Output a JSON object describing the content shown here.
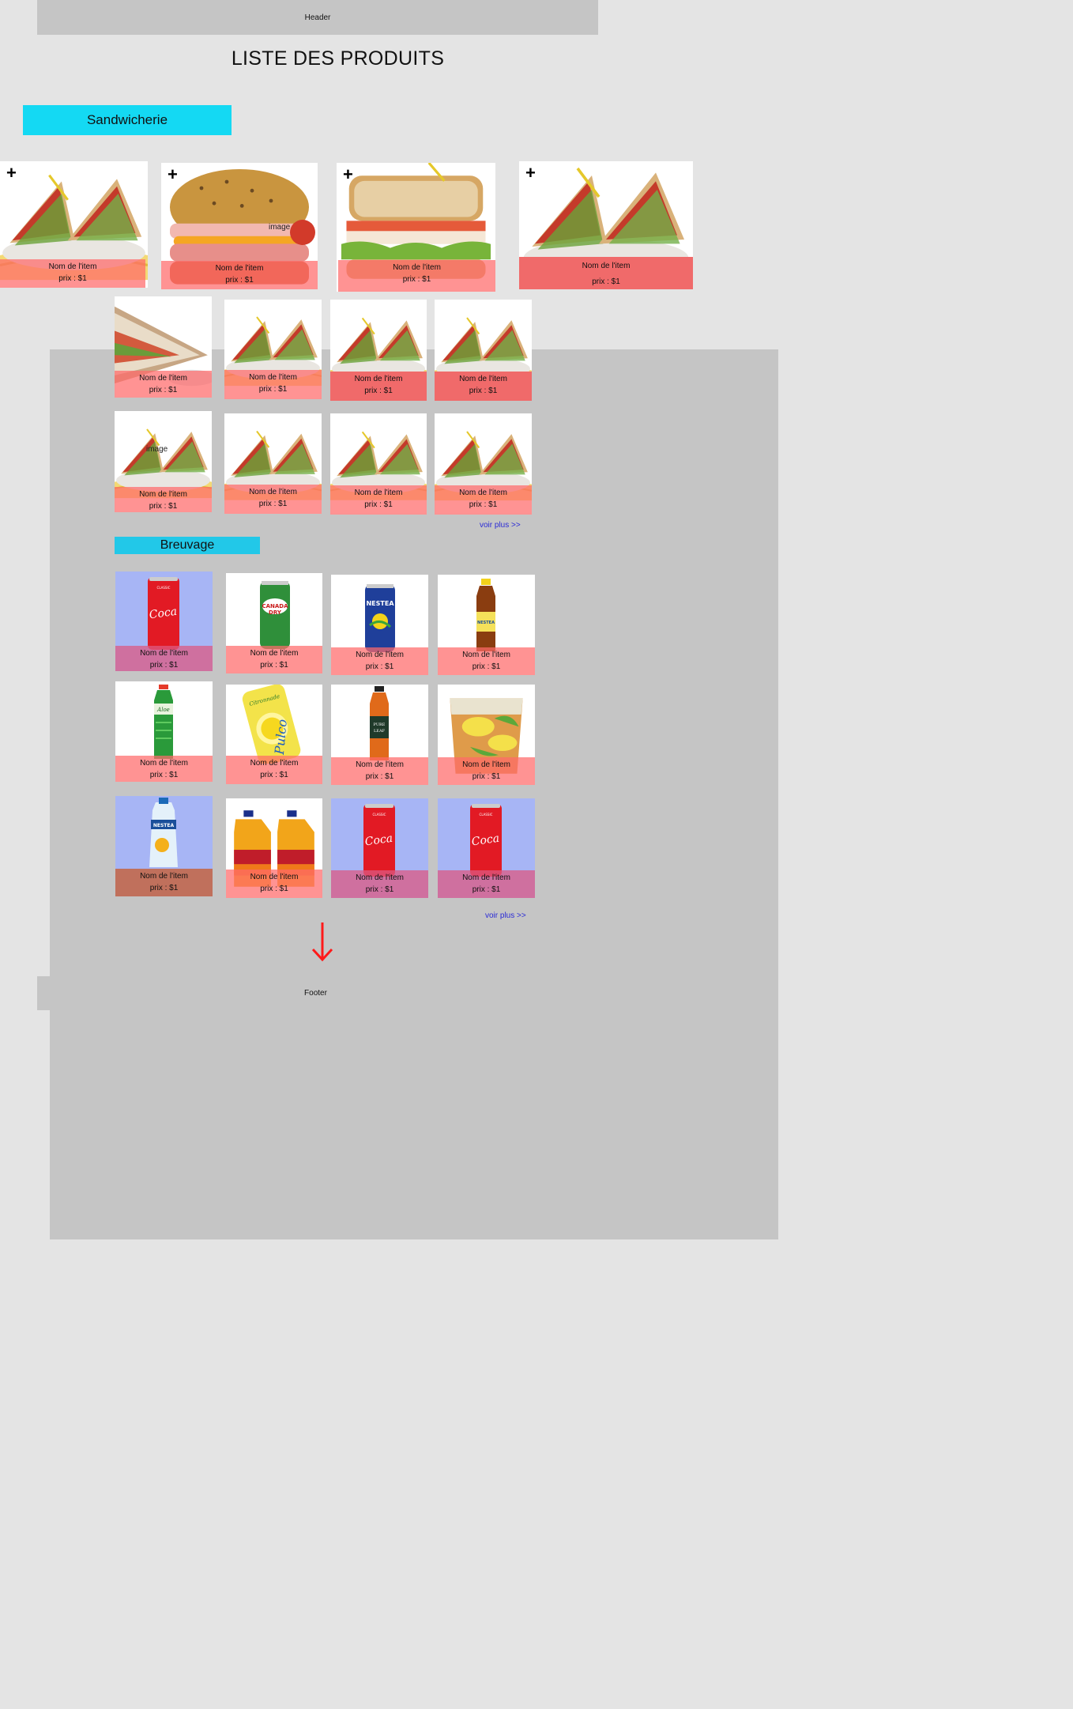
{
  "header": {
    "label": "Header"
  },
  "page_title": "LISTE DES PRODUITS",
  "categories": {
    "sandwich": {
      "label": "Sandwicherie",
      "more": "voir plus >>"
    },
    "drinks": {
      "label": "Breuvage",
      "more": "voir plus >>"
    }
  },
  "item": {
    "name": "Nom de l'item",
    "price": "prix : $1"
  },
  "image_label": "image",
  "footer": {
    "label": "Footer"
  },
  "colors": {
    "accent": "#14d9f3",
    "card_overlay": "#ff6f6f",
    "link": "#2a2ad6",
    "arrow": "#ff1a1a"
  }
}
